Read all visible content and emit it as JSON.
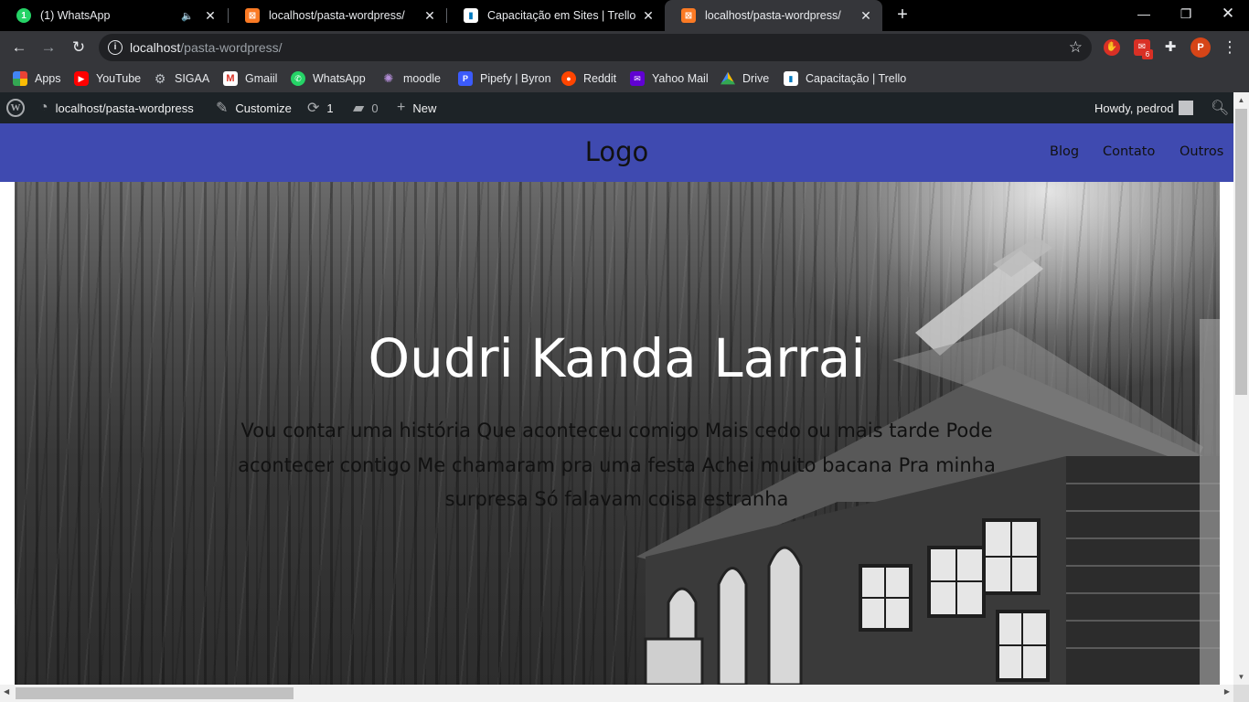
{
  "browser": {
    "tabs": [
      {
        "title": "(1) WhatsApp",
        "favicon": "whatsapp-icon",
        "color": "#25d366",
        "glyph": "1"
      },
      {
        "title": "localhost/pasta-wordpress/",
        "favicon": "xampp-icon",
        "color": "#fb7a24",
        "glyph": "⊠"
      },
      {
        "title": "Capacitação em Sites | Trello",
        "favicon": "trello-icon",
        "color": "#ffffff",
        "glyph": "▮"
      },
      {
        "title": "localhost/pasta-wordpress/",
        "favicon": "xampp-icon",
        "color": "#fb7a24",
        "glyph": "⊠"
      }
    ],
    "url": {
      "host": "localhost",
      "path": "/pasta-wordpress/"
    },
    "gmail_badge": "6",
    "profile_initial": "P"
  },
  "bookmarks": [
    {
      "label": "Apps",
      "icon": "apps-grid-icon",
      "color": "#ea4335"
    },
    {
      "label": "YouTube",
      "icon": "youtube-icon",
      "color": "#ff0000"
    },
    {
      "label": "SIGAA",
      "icon": "sigaa-icon",
      "color": "#5f6368"
    },
    {
      "label": "Gmaiil",
      "icon": "gmail-icon",
      "color": "#ffffff"
    },
    {
      "label": "WhatsApp",
      "icon": "whatsapp-icon",
      "color": "#25d366"
    },
    {
      "label": "moodle",
      "icon": "moodle-icon",
      "color": "#8e6fb5"
    },
    {
      "label": "Pipefy | Byron",
      "icon": "pipefy-icon",
      "color": "#3b5bfd"
    },
    {
      "label": "Reddit",
      "icon": "reddit-icon",
      "color": "#ff4500"
    },
    {
      "label": "Yahoo Mail",
      "icon": "yahoo-mail-icon",
      "color": "#6001d2"
    },
    {
      "label": "Drive",
      "icon": "drive-icon",
      "color": "#fbbc04"
    },
    {
      "label": "Capacitação | Trello",
      "icon": "trello-icon",
      "color": "#ffffff"
    }
  ],
  "admin_bar": {
    "site": "localhost/pasta-wordpress",
    "customize": "Customize",
    "updates": "1",
    "comments": "0",
    "new": "New",
    "howdy": "Howdy, pedrod"
  },
  "site": {
    "logo": "Logo",
    "menu": [
      "Blog",
      "Contato",
      "Outros"
    ],
    "header_color": "#3f4ab0"
  },
  "hero": {
    "title": "Oudri Kanda Larrai",
    "text": "Vou contar uma história Que aconteceu comigo Mais cedo ou mais tarde Pode acontecer contigo Me chamaram pra uma festa Achei muito bacana Pra minha surpresa Só falavam coisa estranha"
  }
}
